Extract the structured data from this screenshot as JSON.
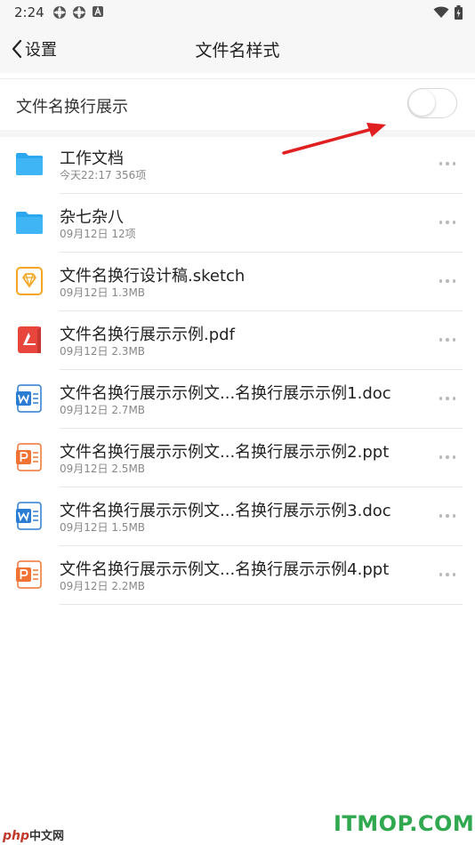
{
  "status_bar": {
    "time": "2:24"
  },
  "header": {
    "back_label": "设置",
    "title": "文件名样式"
  },
  "toggle": {
    "label": "文件名换行展示",
    "enabled": false
  },
  "colors": {
    "accent_arrow": "#e02020",
    "folder": "#2aa7ef",
    "sketch": "#f5a623",
    "pdf": "#e8453c",
    "word": "#2b7cd3",
    "ppt": "#f07234"
  },
  "files": [
    {
      "name": "工作文档",
      "meta": "今天22:17 356项",
      "icon": "folder-icon"
    },
    {
      "name": "杂七杂八",
      "meta": "09月12日 12项",
      "icon": "folder-icon"
    },
    {
      "name": "文件名换行设计稿.sketch",
      "meta": "09月12日 1.3MB",
      "icon": "sketch-icon"
    },
    {
      "name": "文件名换行展示示例.pdf",
      "meta": "09月12日 2.3MB",
      "icon": "pdf-icon"
    },
    {
      "name": "文件名换行展示示例文...名换行展示示例1.doc",
      "meta": "09月12日 2.7MB",
      "icon": "word-icon"
    },
    {
      "name": "文件名换行展示示例文...名换行展示示例2.ppt",
      "meta": "09月12日 2.5MB",
      "icon": "ppt-icon"
    },
    {
      "name": "文件名换行展示示例文...名换行展示示例3.doc",
      "meta": "09月12日 1.5MB",
      "icon": "word-icon"
    },
    {
      "name": "文件名换行展示示例文...名换行展示示例4.ppt",
      "meta": "09月12日 2.2MB",
      "icon": "ppt-icon"
    }
  ],
  "watermarks": {
    "left_brand": "php",
    "left_cn": "中文网",
    "right": "ITMOP.COM"
  }
}
